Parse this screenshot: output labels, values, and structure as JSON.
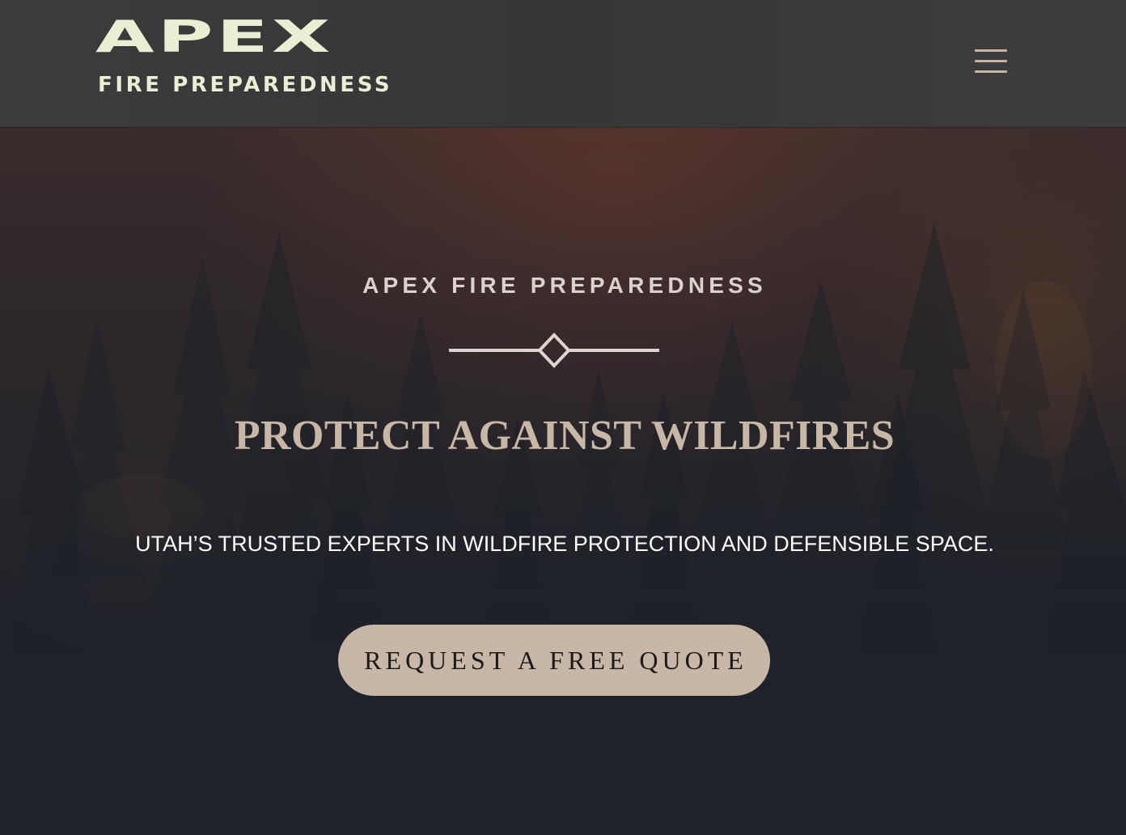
{
  "header": {
    "logo": {
      "wordmark": "APEX",
      "subtitle": "FIRE PREPAREDNESS",
      "color": "#eceed3"
    },
    "menu_icon": "hamburger-menu-icon",
    "menu_color": "#c8b4a0"
  },
  "hero": {
    "title": "APEX FIRE PREPAREDNESS",
    "divider_icon": "diamond-divider-icon",
    "headline": "PROTECT AGAINST WILDFIRES",
    "tagline": "UTAH’S TRUSTED EXPERTS IN WILDFIRE PROTECTION AND DEFENSIBLE SPACE.",
    "cta_label": "REQUEST A FREE QUOTE",
    "accent_color": "#c8b7a6"
  }
}
